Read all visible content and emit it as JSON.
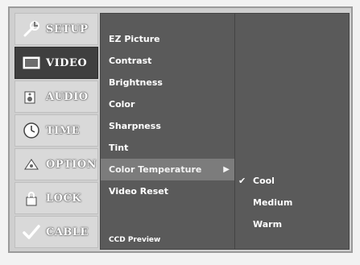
{
  "sidebar": {
    "items": [
      {
        "label": "SETUP",
        "icon": "wrench-icon",
        "active": false
      },
      {
        "label": "VIDEO",
        "icon": "tv-screen-icon",
        "active": true
      },
      {
        "label": "AUDIO",
        "icon": "speaker-icon",
        "active": false
      },
      {
        "label": "TIME",
        "icon": "clock-icon",
        "active": false
      },
      {
        "label": "OPTION",
        "icon": "options-icon",
        "active": false
      },
      {
        "label": "LOCK",
        "icon": "lock-icon",
        "active": false
      },
      {
        "label": "CABLE",
        "icon": "checkmark-icon",
        "active": false
      }
    ]
  },
  "menu": {
    "items": [
      {
        "label": "EZ Picture"
      },
      {
        "label": "Contrast"
      },
      {
        "label": "Brightness"
      },
      {
        "label": "Color"
      },
      {
        "label": "Sharpness"
      },
      {
        "label": "Tint"
      },
      {
        "label": "Color Temperature",
        "selected": true,
        "arrow": "▶"
      },
      {
        "label": "Video Reset"
      }
    ],
    "footer": "CCD Preview"
  },
  "submenu": {
    "items": [
      {
        "label": "Cool",
        "checked": true,
        "check_glyph": "✔"
      },
      {
        "label": "Medium",
        "checked": false
      },
      {
        "label": "Warm",
        "checked": false
      }
    ]
  },
  "colors": {
    "menu_bg": "#5a5a5a",
    "sidebar_active_bg": "#3f3f3f",
    "sidebar_bg": "#d9d9d9",
    "text": "#ffffff"
  }
}
